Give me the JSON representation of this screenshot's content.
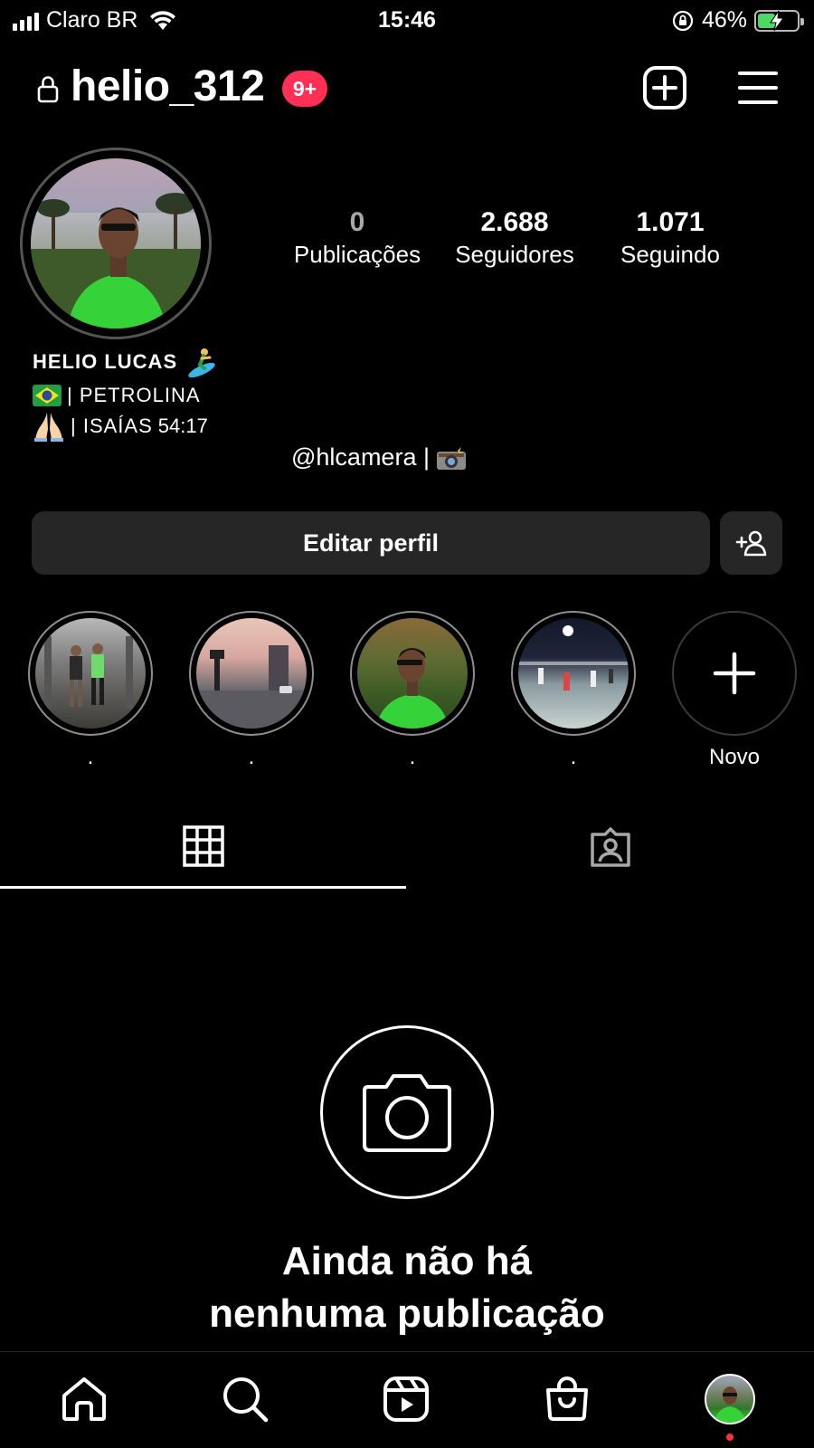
{
  "status_bar": {
    "carrier": "Claro BR",
    "time": "15:46",
    "battery_percent": "46%",
    "battery_level": 0.46
  },
  "header": {
    "username": "helio_312",
    "notification_badge": "9+"
  },
  "stats": {
    "posts_count": "0",
    "posts_label": "Publicações",
    "followers_count": "2.688",
    "followers_label": "Seguidores",
    "following_count": "1.071",
    "following_label": "Seguindo"
  },
  "bio": {
    "name": "HELIO LUCAS",
    "line1": "| PETROLINA",
    "line2_prefix": "| ISAÍAS",
    "line2_ref": "54:17",
    "link": "@hlcamera |"
  },
  "buttons": {
    "edit_profile": "Editar perfil"
  },
  "highlights": [
    {
      "label": "."
    },
    {
      "label": "."
    },
    {
      "label": "."
    },
    {
      "label": "."
    },
    {
      "label": "Novo"
    }
  ],
  "empty_state": {
    "title_line1": "Ainda não há",
    "title_line2": "nenhuma publicação"
  },
  "colors": {
    "background": "#000000",
    "badge": "#ff2f55",
    "button_bg": "#262626",
    "battery_fill": "#4cd964"
  },
  "icons": [
    "lock-icon",
    "new-post-icon",
    "menu-icon",
    "add-person-icon",
    "plus-icon",
    "grid-icon",
    "tagged-icon",
    "camera-icon",
    "home-icon",
    "search-icon",
    "reels-icon",
    "shop-icon"
  ]
}
